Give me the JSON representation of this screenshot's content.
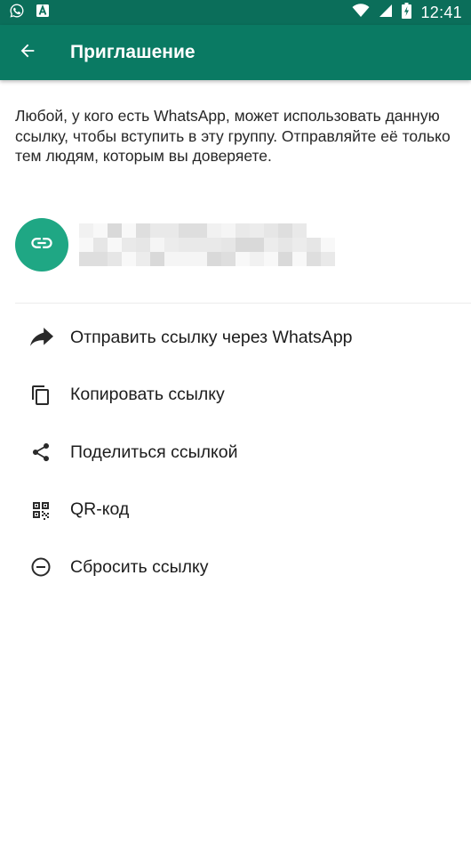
{
  "status_bar": {
    "time": "12:41",
    "icons": [
      "whatsapp-notification-icon",
      "a-notification-icon",
      "wifi-icon",
      "signal-icon",
      "battery-icon"
    ]
  },
  "toolbar": {
    "title": "Приглашение",
    "back_icon": "arrow-left-icon"
  },
  "description": "Любой, у кого есть WhatsApp, может использовать данную ссылку, чтобы вступить в эту группу. Отправляйте её только тем людям, которым вы доверяете.",
  "invite_link": {
    "icon": "link-icon"
  },
  "menu": [
    {
      "label": "Отправить ссылку через WhatsApp",
      "icon": "forward-icon"
    },
    {
      "label": "Копировать ссылку",
      "icon": "copy-icon"
    },
    {
      "label": "Поделиться ссылкой",
      "icon": "share-icon"
    },
    {
      "label": "QR-код",
      "icon": "qr-code-icon"
    },
    {
      "label": "Сбросить ссылку",
      "icon": "minus-circle-icon"
    }
  ],
  "colors": {
    "status_bar": "#0b6e5a",
    "toolbar": "#0a7a63",
    "accent": "#1fa784"
  }
}
